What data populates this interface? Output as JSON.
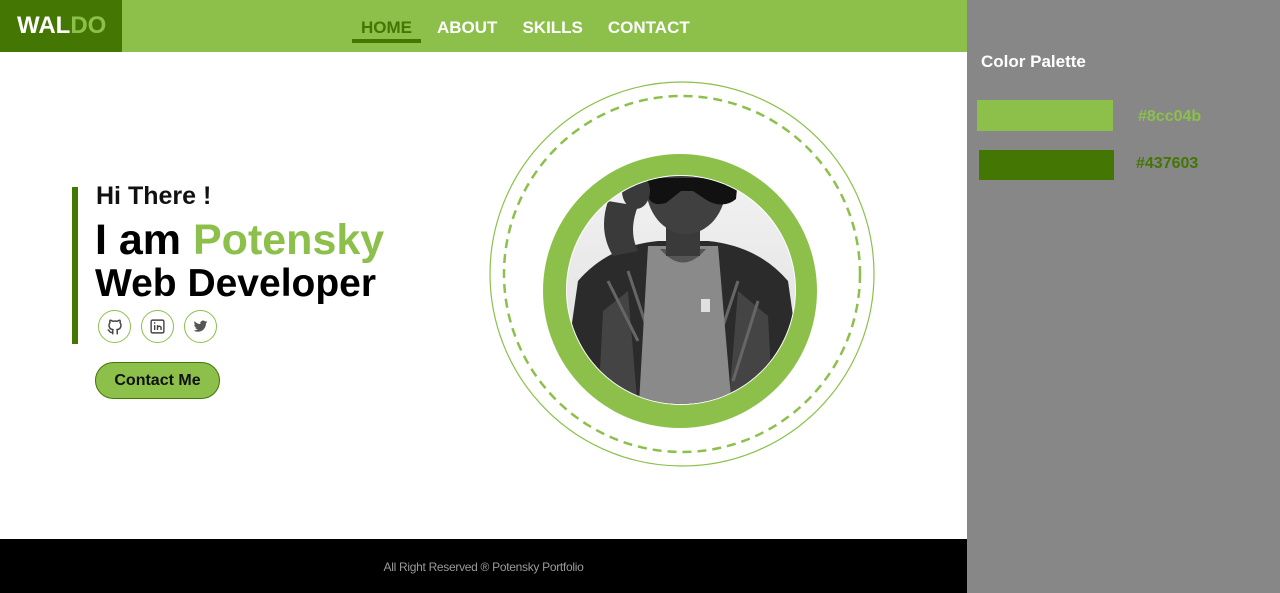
{
  "header": {
    "logo_part1": "WAL",
    "logo_part2": "DO",
    "nav": [
      {
        "label": "HOME",
        "active": true
      },
      {
        "label": "ABOUT",
        "active": false
      },
      {
        "label": "SKILLS",
        "active": false
      },
      {
        "label": "CONTACT",
        "active": false
      }
    ]
  },
  "hero": {
    "greeting": "Hi There !",
    "intro": "I am",
    "name": "Potensky",
    "role": "Web Developer",
    "socials": [
      {
        "icon": "github-icon"
      },
      {
        "icon": "linkedin-icon"
      },
      {
        "icon": "twitter-icon"
      }
    ],
    "cta_label": "Contact Me"
  },
  "footer": {
    "text": "All Right Reserved ® Potensky Portfolio"
  },
  "palette": {
    "title": "Color Palette",
    "colors": [
      {
        "hex": "#8cc04b"
      },
      {
        "hex": "#437603"
      }
    ]
  },
  "colors": {
    "accent": "#8cc04b",
    "dark_accent": "#437603",
    "panel_bg": "#878787",
    "footer_bg": "#000000"
  }
}
